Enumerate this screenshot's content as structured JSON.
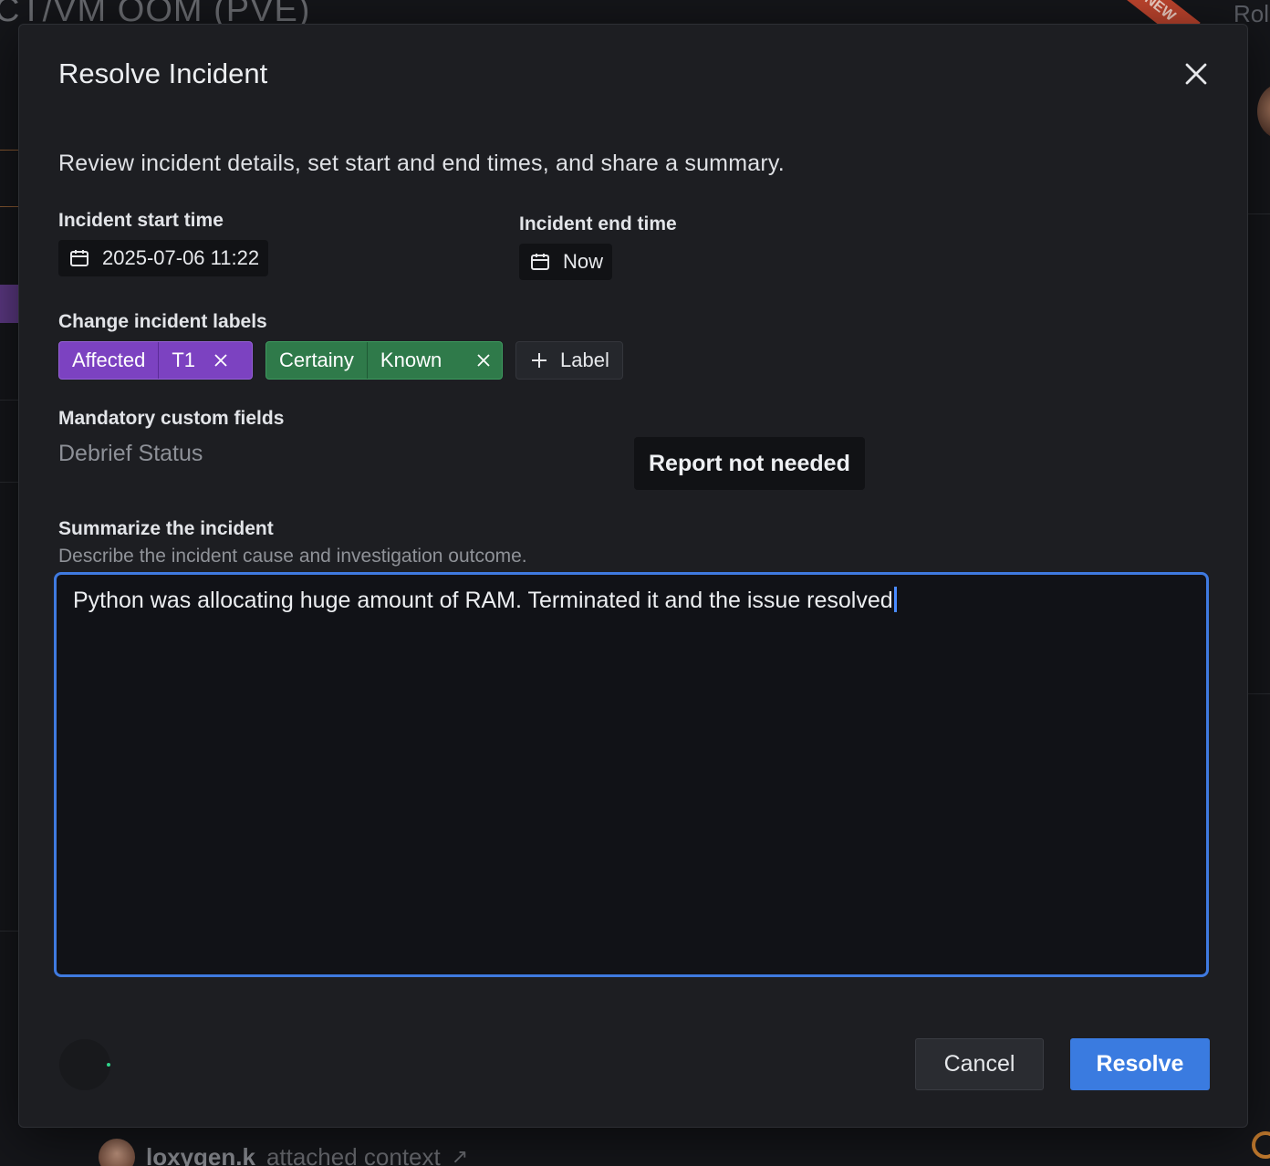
{
  "background": {
    "page_title_fragment": "CT/VM OOM (PVE)",
    "new_badge": "NEW",
    "right_header_fragment": "Rol",
    "footer": {
      "user": "loxygen.k",
      "action": "attached context"
    }
  },
  "modal": {
    "title": "Resolve Incident",
    "description": "Review incident details, set start and end times, and share a summary.",
    "start_time": {
      "label": "Incident start time",
      "value": "2025-07-06 11:22",
      "icon": "calendar-icon"
    },
    "end_time": {
      "label": "Incident end time",
      "value": "Now",
      "icon": "calendar-icon"
    },
    "labels": {
      "heading": "Change incident labels",
      "items": [
        {
          "key": "Affected",
          "value": "T1",
          "color": "#7c42c1"
        },
        {
          "key": "Certainy",
          "value": "Known",
          "color": "#2f7a4a"
        }
      ],
      "add_button": "Label"
    },
    "custom_fields": {
      "heading": "Mandatory custom fields",
      "field_name": "Debrief Status",
      "field_value": "Report not needed"
    },
    "summary": {
      "heading": "Summarize the incident",
      "hint": "Describe the incident cause and investigation outcome.",
      "text": "Python was allocating huge amount of RAM. Terminated it and the issue resolved"
    },
    "buttons": {
      "cancel": "Cancel",
      "resolve": "Resolve"
    },
    "colors": {
      "accent": "#3a7be0",
      "focus_border": "#3f7ae0"
    }
  }
}
